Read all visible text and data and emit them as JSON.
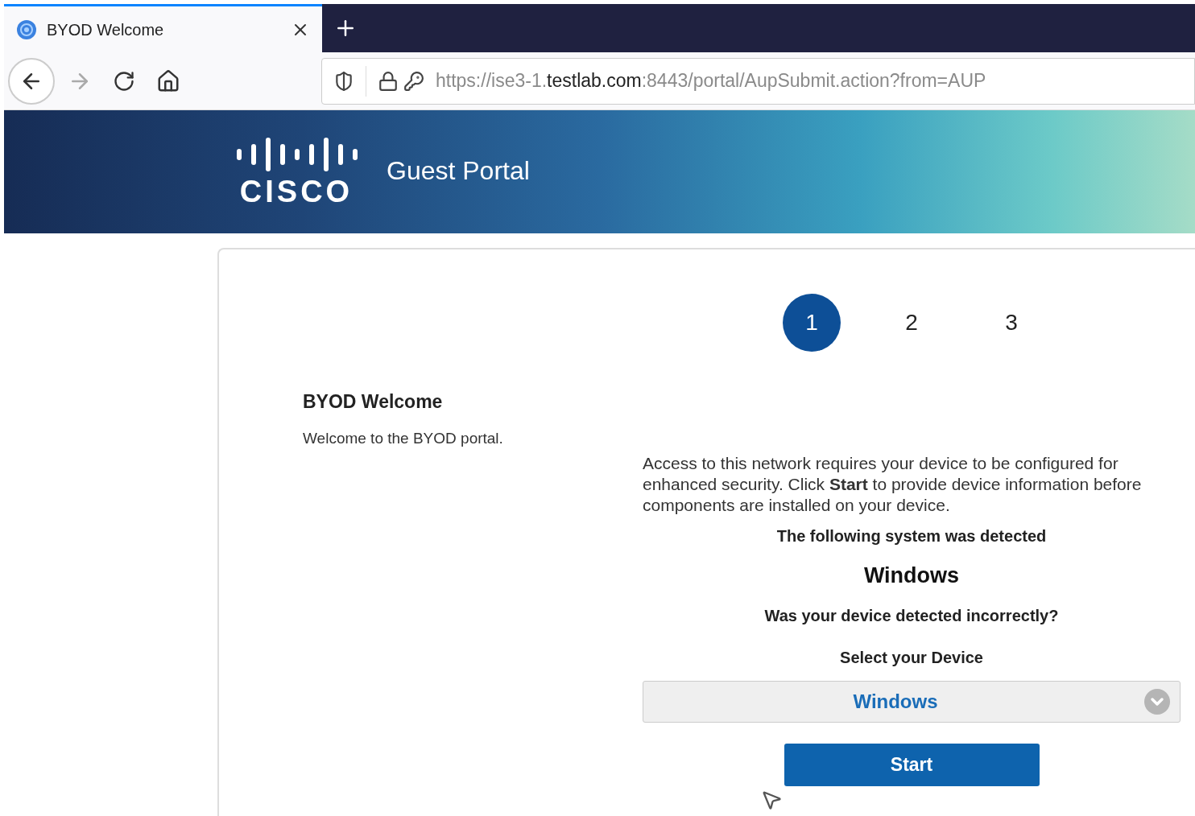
{
  "browser": {
    "tab": {
      "title": "BYOD Welcome",
      "selected": true
    },
    "address": {
      "scheme_and_host_prefix": "https://ise3-1.",
      "domain": "testlab.com",
      "rest": ":8443/portal/AupSubmit.action?from=AUP"
    }
  },
  "banner": {
    "logo_text": "CISCO",
    "title": "Guest Portal"
  },
  "steps": [
    {
      "label": "1",
      "selected": true
    },
    {
      "label": "2",
      "selected": false
    },
    {
      "label": "3",
      "selected": false
    }
  ],
  "welcome": {
    "title": "BYOD Welcome",
    "subtitle": "Welcome to the BYOD portal."
  },
  "content": {
    "description": "Access to this network requires your device to be configured for enhanced security. Click **Start** to provide device information before components are installed on your device.",
    "detected_label": "The following system was detected",
    "detected_system": "Windows",
    "question": "Was your device detected incorrectly?",
    "select_label": "Select your Device",
    "device_value": "Windows",
    "button": "Start"
  }
}
